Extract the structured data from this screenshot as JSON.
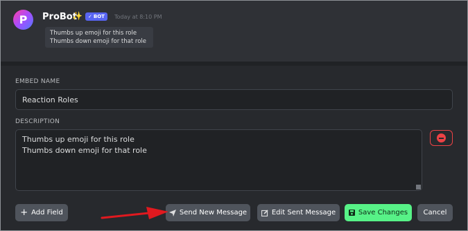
{
  "message": {
    "bot_name": "ProBot",
    "sparkle_emoji": "✨",
    "badge": "BOT",
    "badge_check": "✓",
    "timestamp": "Today at 8:10 PM",
    "avatar_letter": "P",
    "embed_preview_lines": [
      "Thumbs up emoji for this role",
      "Thumbs down emoji for that role"
    ]
  },
  "editor": {
    "embed_name_label": "EMBED NAME",
    "embed_name_value": "Reaction Roles",
    "description_label": "DESCRIPTION",
    "description_value": "Thumbs up emoji for this role\nThumbs down emoji for that role"
  },
  "buttons": {
    "add_field": "Add Field",
    "send_new_message": "Send New Message",
    "edit_sent_message": "Edit Sent Message",
    "save_changes": "Save Changes",
    "cancel": "Cancel"
  },
  "colors": {
    "accent_green": "#57f287",
    "danger_red": "#ed4245",
    "blurple": "#5865f2",
    "annotation_arrow": "#e0191f"
  }
}
